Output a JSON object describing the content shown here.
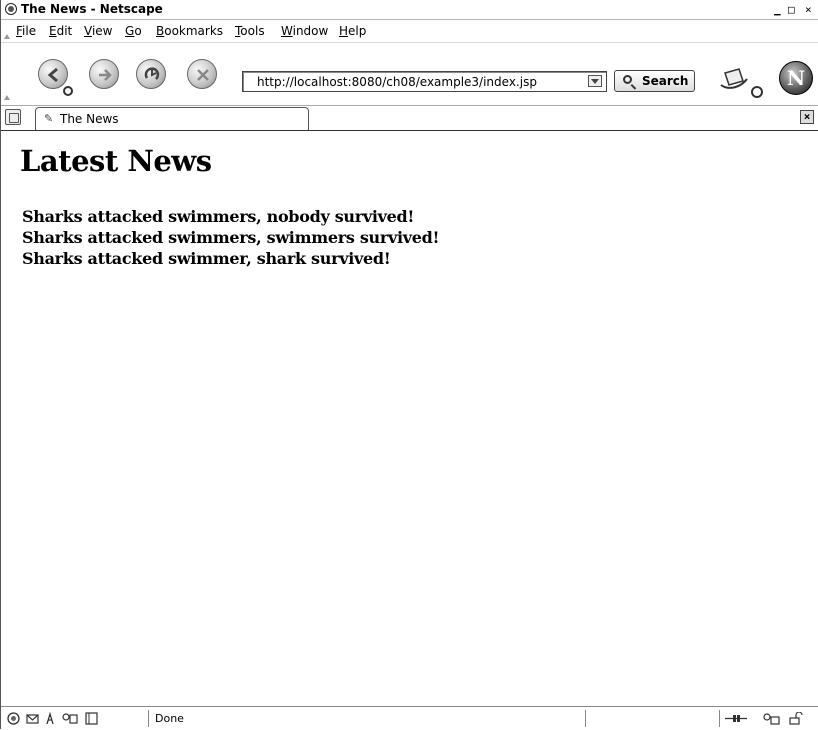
{
  "window": {
    "title": "The News - Netscape",
    "controls": {
      "minimize": "_",
      "maximize": "□",
      "close": "×"
    }
  },
  "menubar": {
    "items": [
      {
        "label": "File",
        "accel": "F",
        "rest": "ile"
      },
      {
        "label": "Edit",
        "accel": "E",
        "rest": "dit"
      },
      {
        "label": "View",
        "accel": "V",
        "rest": "iew"
      },
      {
        "label": "Go",
        "accel": "G",
        "rest": "o"
      },
      {
        "label": "Bookmarks",
        "accel": "B",
        "rest": "ookmarks"
      },
      {
        "label": "Tools",
        "accel": "T",
        "rest": "ools"
      },
      {
        "label": "Window",
        "accel": "W",
        "rest": "indow"
      },
      {
        "label": "Help",
        "accel": "H",
        "rest": "elp"
      }
    ]
  },
  "toolbar": {
    "buttons": [
      "back-icon",
      "forward-icon",
      "reload-icon",
      "stop-icon"
    ],
    "url": "http://localhost:8080/ch08/example3/index.jsp",
    "search_label": "Search",
    "logo_letter": "N"
  },
  "tabs": [
    {
      "label": "The News",
      "icon": "page-icon"
    }
  ],
  "page": {
    "heading": "Latest News",
    "headlines": [
      "Sharks attacked swimmers, nobody survived!",
      "Sharks attacked swimmers, swimmers survived!",
      "Sharks attacked swimmer, shark survived!"
    ]
  },
  "statusbar": {
    "status": "Done",
    "left_icons": [
      "navigator-icon",
      "mail-icon",
      "composer-icon",
      "address-book-icon",
      "chat-icon"
    ],
    "right_icons": [
      "online-icon",
      "security-icon",
      "lock-icon"
    ]
  },
  "colors": {
    "chrome": "#ffffff",
    "border": "#555555",
    "text": "#000000"
  }
}
